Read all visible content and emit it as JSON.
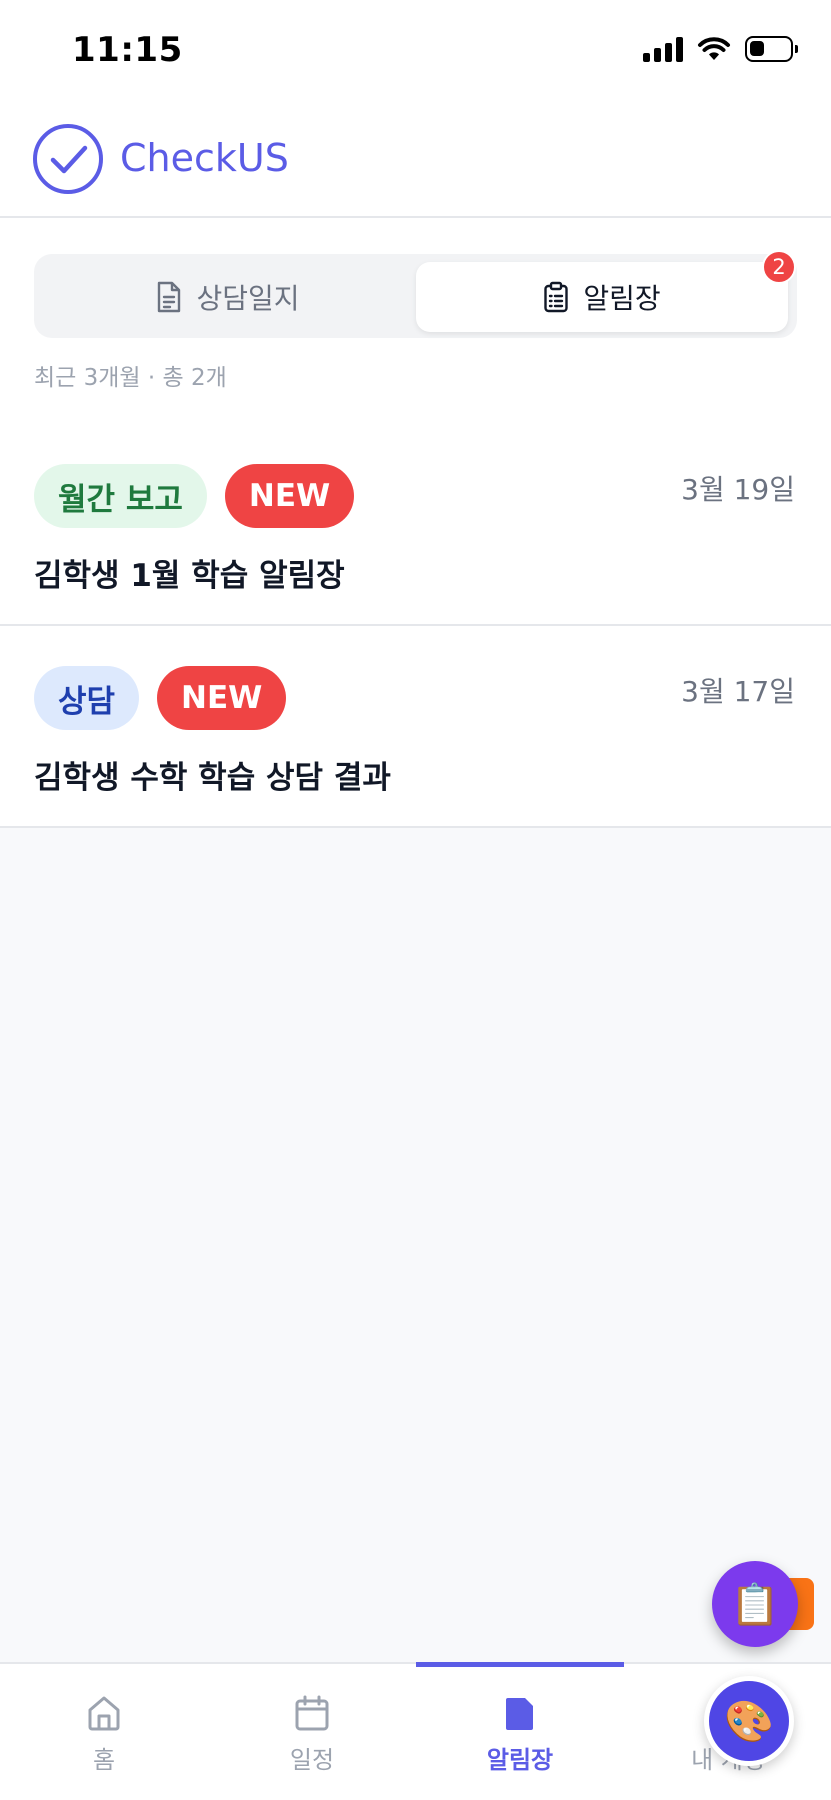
{
  "status_bar": {
    "time": "11:15"
  },
  "header": {
    "app_name": "CheckUS"
  },
  "segmented": {
    "left_label": "상담일지",
    "right_label": "알림장",
    "right_badge": "2"
  },
  "meta": "최근 3개월 · 총 2개",
  "notices": [
    {
      "tag": "월간 보고",
      "new_label": "NEW",
      "date": "3월 19일",
      "title": "김학생 1월 학습 알림장"
    },
    {
      "tag": "상담",
      "new_label": "NEW",
      "date": "3월 17일",
      "title": "김학생 수학 학습 상담 결과"
    }
  ],
  "fab": {
    "clipboard_icon": "📋",
    "palette_icon": "🎨"
  },
  "tab_bar": {
    "home": "홈",
    "schedule": "일정",
    "notice": "알림장",
    "mine": "내 계정"
  },
  "colors": {
    "accent": "#5b5ce6",
    "new_badge": "#ef4444"
  }
}
